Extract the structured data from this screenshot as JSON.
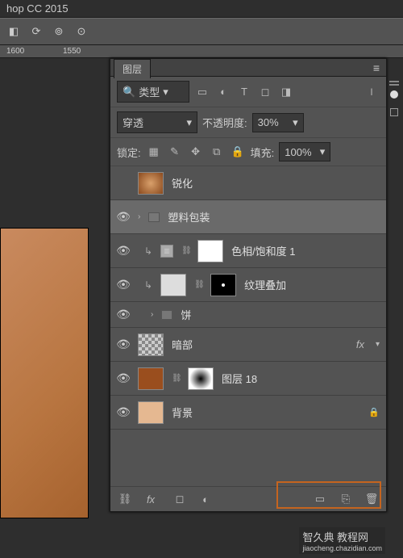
{
  "app_title": "hop CC 2015",
  "ruler_marks": [
    "1600",
    "1550"
  ],
  "panel": {
    "tab_label": "图层",
    "filter": {
      "kind_label": "类型"
    },
    "blend_mode": "穿透",
    "opacity": {
      "label": "不透明度:",
      "value": "30%"
    },
    "lock": {
      "label": "锁定:",
      "fill_label": "填充:",
      "fill_value": "100%"
    }
  },
  "layers": [
    {
      "name": "锐化"
    },
    {
      "name": "塑料包装"
    },
    {
      "name": "色相/饱和度 1"
    },
    {
      "name": "纹理叠加"
    },
    {
      "name": "饼"
    },
    {
      "name": "暗部"
    },
    {
      "name": "图层 18"
    },
    {
      "name": "背景"
    }
  ],
  "fx_label": "fx",
  "watermark": {
    "line1": "智久典 教程网",
    "line2": "jiaocheng.chazidian.com"
  }
}
